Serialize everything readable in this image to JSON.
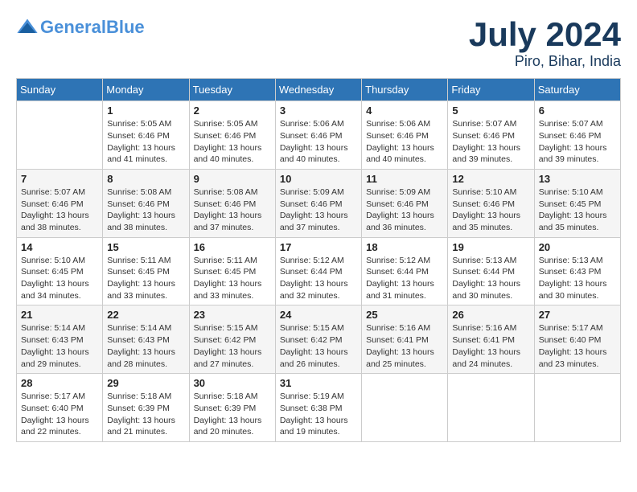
{
  "header": {
    "logo_general": "General",
    "logo_blue": "Blue",
    "month": "July 2024",
    "location": "Piro, Bihar, India"
  },
  "weekdays": [
    "Sunday",
    "Monday",
    "Tuesday",
    "Wednesday",
    "Thursday",
    "Friday",
    "Saturday"
  ],
  "weeks": [
    [
      {
        "day": "",
        "info": ""
      },
      {
        "day": "1",
        "info": "Sunrise: 5:05 AM\nSunset: 6:46 PM\nDaylight: 13 hours and 41 minutes."
      },
      {
        "day": "2",
        "info": "Sunrise: 5:05 AM\nSunset: 6:46 PM\nDaylight: 13 hours and 40 minutes."
      },
      {
        "day": "3",
        "info": "Sunrise: 5:06 AM\nSunset: 6:46 PM\nDaylight: 13 hours and 40 minutes."
      },
      {
        "day": "4",
        "info": "Sunrise: 5:06 AM\nSunset: 6:46 PM\nDaylight: 13 hours and 40 minutes."
      },
      {
        "day": "5",
        "info": "Sunrise: 5:07 AM\nSunset: 6:46 PM\nDaylight: 13 hours and 39 minutes."
      },
      {
        "day": "6",
        "info": "Sunrise: 5:07 AM\nSunset: 6:46 PM\nDaylight: 13 hours and 39 minutes."
      }
    ],
    [
      {
        "day": "7",
        "info": ""
      },
      {
        "day": "8",
        "info": "Sunrise: 5:08 AM\nSunset: 6:46 PM\nDaylight: 13 hours and 38 minutes."
      },
      {
        "day": "9",
        "info": "Sunrise: 5:08 AM\nSunset: 6:46 PM\nDaylight: 13 hours and 37 minutes."
      },
      {
        "day": "10",
        "info": "Sunrise: 5:09 AM\nSunset: 6:46 PM\nDaylight: 13 hours and 37 minutes."
      },
      {
        "day": "11",
        "info": "Sunrise: 5:09 AM\nSunset: 6:46 PM\nDaylight: 13 hours and 36 minutes."
      },
      {
        "day": "12",
        "info": "Sunrise: 5:10 AM\nSunset: 6:46 PM\nDaylight: 13 hours and 35 minutes."
      },
      {
        "day": "13",
        "info": "Sunrise: 5:10 AM\nSunset: 6:45 PM\nDaylight: 13 hours and 35 minutes."
      }
    ],
    [
      {
        "day": "14",
        "info": ""
      },
      {
        "day": "15",
        "info": "Sunrise: 5:11 AM\nSunset: 6:45 PM\nDaylight: 13 hours and 33 minutes."
      },
      {
        "day": "16",
        "info": "Sunrise: 5:11 AM\nSunset: 6:45 PM\nDaylight: 13 hours and 33 minutes."
      },
      {
        "day": "17",
        "info": "Sunrise: 5:12 AM\nSunset: 6:44 PM\nDaylight: 13 hours and 32 minutes."
      },
      {
        "day": "18",
        "info": "Sunrise: 5:12 AM\nSunset: 6:44 PM\nDaylight: 13 hours and 31 minutes."
      },
      {
        "day": "19",
        "info": "Sunrise: 5:13 AM\nSunset: 6:44 PM\nDaylight: 13 hours and 30 minutes."
      },
      {
        "day": "20",
        "info": "Sunrise: 5:13 AM\nSunset: 6:43 PM\nDaylight: 13 hours and 30 minutes."
      }
    ],
    [
      {
        "day": "21",
        "info": ""
      },
      {
        "day": "22",
        "info": "Sunrise: 5:14 AM\nSunset: 6:43 PM\nDaylight: 13 hours and 28 minutes."
      },
      {
        "day": "23",
        "info": "Sunrise: 5:15 AM\nSunset: 6:42 PM\nDaylight: 13 hours and 27 minutes."
      },
      {
        "day": "24",
        "info": "Sunrise: 5:15 AM\nSunset: 6:42 PM\nDaylight: 13 hours and 26 minutes."
      },
      {
        "day": "25",
        "info": "Sunrise: 5:16 AM\nSunset: 6:41 PM\nDaylight: 13 hours and 25 minutes."
      },
      {
        "day": "26",
        "info": "Sunrise: 5:16 AM\nSunset: 6:41 PM\nDaylight: 13 hours and 24 minutes."
      },
      {
        "day": "27",
        "info": "Sunrise: 5:17 AM\nSunset: 6:40 PM\nDaylight: 13 hours and 23 minutes."
      }
    ],
    [
      {
        "day": "28",
        "info": "Sunrise: 5:17 AM\nSunset: 6:40 PM\nDaylight: 13 hours and 22 minutes."
      },
      {
        "day": "29",
        "info": "Sunrise: 5:18 AM\nSunset: 6:39 PM\nDaylight: 13 hours and 21 minutes."
      },
      {
        "day": "30",
        "info": "Sunrise: 5:18 AM\nSunset: 6:39 PM\nDaylight: 13 hours and 20 minutes."
      },
      {
        "day": "31",
        "info": "Sunrise: 5:19 AM\nSunset: 6:38 PM\nDaylight: 13 hours and 19 minutes."
      },
      {
        "day": "",
        "info": ""
      },
      {
        "day": "",
        "info": ""
      },
      {
        "day": "",
        "info": ""
      }
    ]
  ],
  "week7_sunday": "Sunrise: 5:07 AM\nSunset: 6:46 PM\nDaylight: 13 hours and 38 minutes.",
  "week14_sunday": "Sunrise: 5:10 AM\nSunset: 6:45 PM\nDaylight: 13 hours and 34 minutes.",
  "week21_sunday": "Sunrise: 5:14 AM\nSunset: 6:43 PM\nDaylight: 13 hours and 29 minutes."
}
